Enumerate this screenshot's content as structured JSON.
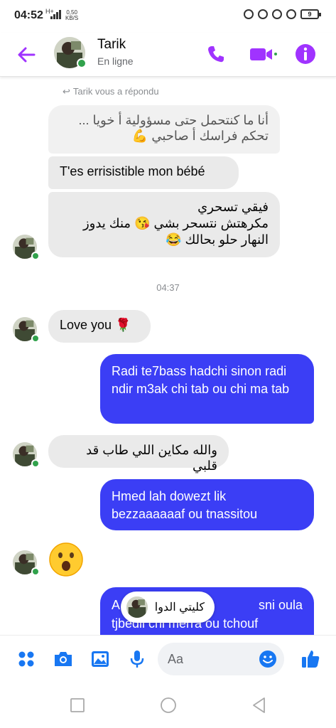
{
  "status_bar": {
    "time": "04:52",
    "signal_label": "H+",
    "speed_value": "0,50",
    "speed_unit": "KB/S",
    "battery": "9"
  },
  "header": {
    "contact_name": "Tarik",
    "contact_status": "En ligne"
  },
  "chat": {
    "reply_note": "Tarik vous a répondu",
    "messages": {
      "m1_line1": "أنا ما كنتحمل حتى مسؤولية أ خويا ...",
      "m1_line2": "تحكم فراسك أ صاحبي",
      "m2": "T'es errisistible mon bébé",
      "m3_line1": "فيقي تسحري",
      "m3_line2": "مكرهتش نتسحر بشي",
      "m3_line2b": "منك يدوز",
      "m3_line3": "النهار حلو بحالك",
      "timestamp": "04:37",
      "m4": "Love you",
      "m5": "Radi te7bass hadchi sinon radi ndir m3ak chi tab ou chi ma tab",
      "m6": "والله مكاين اللي طاب قد قلبي",
      "m7": "Hmed lah dowezt lik bezzaaaaaaf  ou tnassitou",
      "m8_line1": "A",
      "m8_line1_end": "sni oula",
      "m8_line2": "tjbedli chi merra ou tchouf"
    },
    "toast_label": "كليتي الدوا"
  },
  "composer": {
    "placeholder": "Aa"
  },
  "icons": {
    "back": "back-arrow-icon",
    "call": "phone-icon",
    "video": "video-camera-icon",
    "info": "info-icon",
    "apps": "apps-grid-icon",
    "camera": "camera-icon",
    "gallery": "image-icon",
    "mic": "microphone-icon",
    "emoji": "smiley-icon",
    "like": "thumbs-up-icon"
  },
  "colors": {
    "accent_purple": "#a033ff",
    "outgoing_bubble": "#3b3ef5",
    "incoming_bubble": "#eaeaea",
    "composer_blue": "#1877f2",
    "online_green": "#31a24c"
  }
}
